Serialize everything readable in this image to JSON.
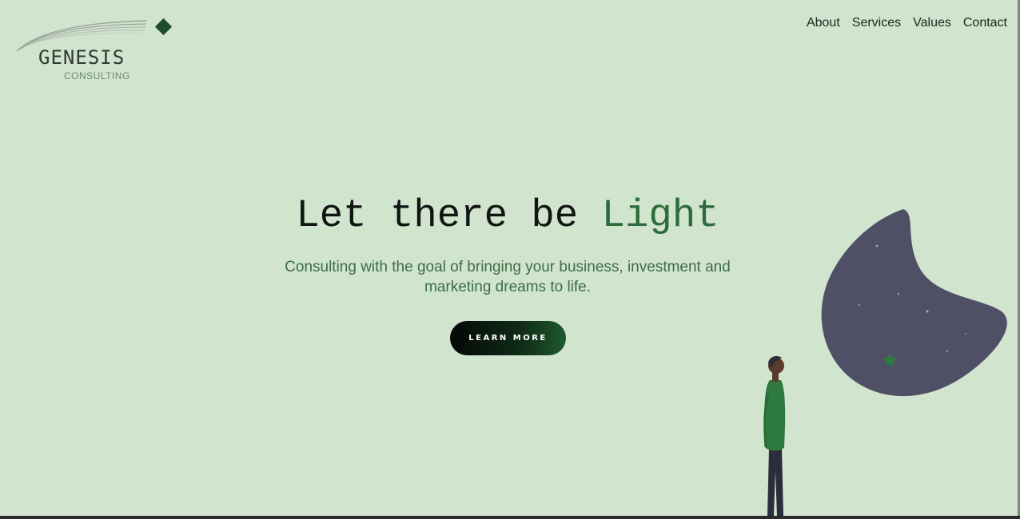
{
  "logo": {
    "brand": "GENESIS",
    "sub": "CONSULTING"
  },
  "nav": {
    "items": [
      "About",
      "Services",
      "Values",
      "Contact"
    ]
  },
  "hero": {
    "title_part1": "Let there be ",
    "title_accent": "Light",
    "subtitle_line1": "Consulting with the goal of bringing your business, investment and",
    "subtitle_line2": "marketing dreams to life.",
    "cta_label": "LEARN MORE"
  },
  "colors": {
    "background": "#d1e4cd",
    "accent_green": "#2e6b3c",
    "moon": "#4f5066",
    "shirt": "#2e7a3f"
  }
}
